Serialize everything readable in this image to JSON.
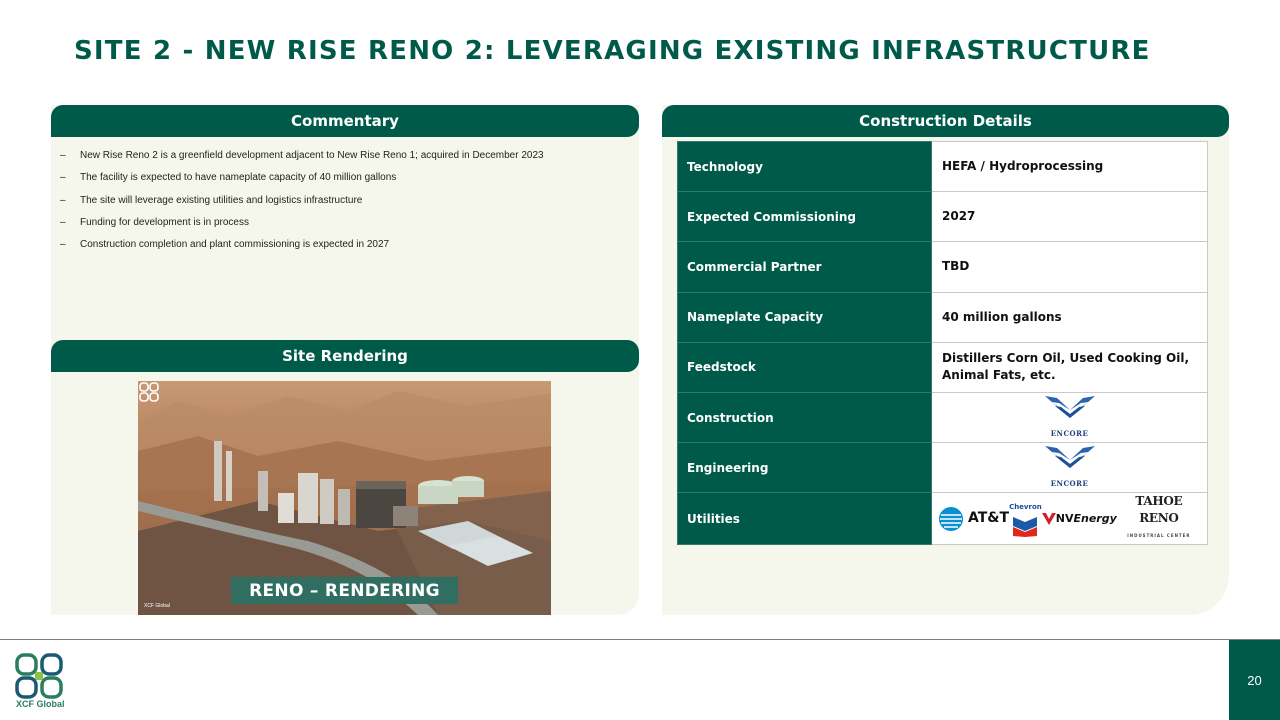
{
  "slide": {
    "title": "SITE 2 - NEW RISE RENO 2: LEVERAGING EXISTING INFRASTRUCTURE",
    "page_number": "20"
  },
  "commentary": {
    "header": "Commentary",
    "bullets": [
      "New Rise Reno 2 is a greenfield development adjacent to New Rise Reno 1; acquired in December 2023",
      "The facility is expected to have nameplate capacity of 40 million gallons",
      "The site will leverage existing utilities and logistics infrastructure",
      "Funding for development is in process",
      "Construction completion and plant commissioning is expected in 2027"
    ],
    "dash": "–"
  },
  "rendering": {
    "header": "Site Rendering",
    "caption": "RENO – RENDERING",
    "logo_text": "XCF Global"
  },
  "construction": {
    "header": "Construction Details",
    "rows": [
      {
        "label": "Technology",
        "value": "HEFA / Hydroprocessing"
      },
      {
        "label": "Expected Commissioning",
        "value": "2027"
      },
      {
        "label": "Commercial Partner",
        "value": "TBD"
      },
      {
        "label": "Nameplate Capacity",
        "value": "40 million gallons"
      },
      {
        "label": "Feedstock",
        "value": "Distillers Corn Oil, Used Cooking Oil, Animal Fats, etc."
      },
      {
        "label": "Construction",
        "logo": "ENCORE"
      },
      {
        "label": "Engineering",
        "logo": "ENCORE"
      },
      {
        "label": "Utilities",
        "logos": {
          "att": "AT&T",
          "chevron": "Chevron",
          "nv_prefix": "NV",
          "nv_suffix": "Energy",
          "tahoe": "TAHOE RENO",
          "tahoe_sub": "INDUSTRIAL CENTER"
        }
      }
    ]
  },
  "footer": {
    "logo_text": "XCF Global"
  },
  "colors": {
    "brand_green": "#005a4a",
    "panel_bg": "#f6f7ec"
  }
}
